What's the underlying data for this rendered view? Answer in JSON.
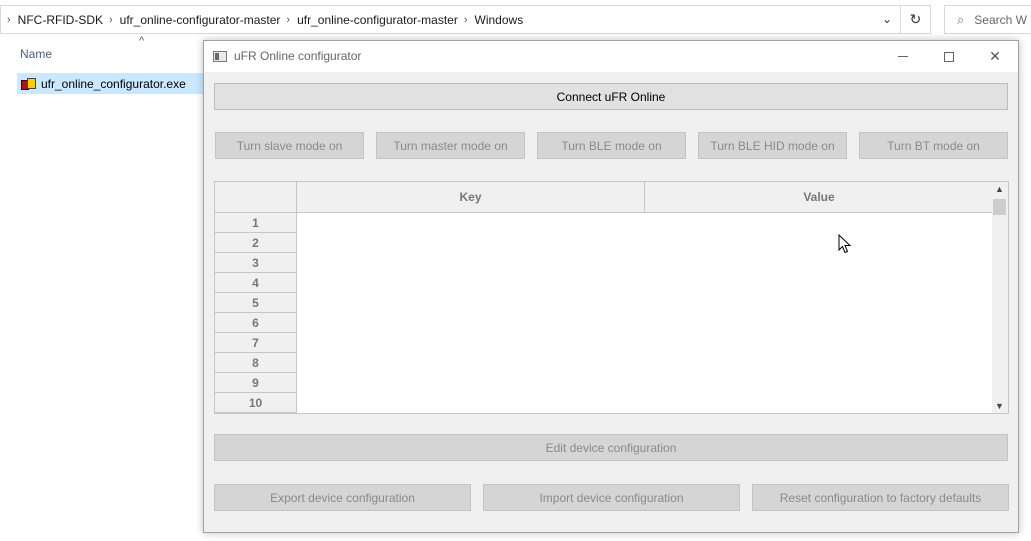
{
  "explorer": {
    "breadcrumbs": [
      "NFC-RFID-SDK",
      "ufr_online-configurator-master",
      "ufr_online-configurator-master",
      "Windows"
    ],
    "search_placeholder": "Search W",
    "column_name": "Name",
    "file_name": "ufr_online_configurator.exe"
  },
  "window": {
    "title": "uFR Online configurator",
    "connect_label": "Connect uFR Online",
    "mode_buttons": [
      "Turn slave mode on",
      "Turn master mode on",
      "Turn BLE mode on",
      "Turn BLE HID mode on",
      "Turn BT mode on"
    ],
    "table": {
      "columns": [
        "Key",
        "Value"
      ],
      "rows": [
        "1",
        "2",
        "3",
        "4",
        "5",
        "6",
        "7",
        "8",
        "9",
        "10"
      ]
    },
    "edit_label": "Edit device configuration",
    "export_label": "Export device configuration",
    "import_label": "Import device configuration",
    "reset_label": "Reset configuration to factory defaults"
  }
}
